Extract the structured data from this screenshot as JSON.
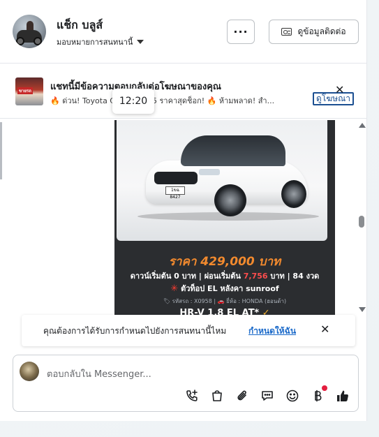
{
  "header": {
    "name": "แช็ก บลูส์",
    "assign_label": "มอบหมายการสนทนานี้",
    "more_label": "···",
    "contact_label": "ดูข้อมูลติดต่อ"
  },
  "ad_banner": {
    "title": "แชทนี้มีข้อความตอบกลับต่อโฆษณาของคุณ",
    "preview": "🔥 ด่วน! Toyota C          rid ปี 2015 ราคาสุดช็อก! 🔥 ห้ามพลาด! สำ...",
    "thumb_text": "ขายรถ",
    "view_ad_label": "ดูโฆษณา",
    "close_label": "✕",
    "tooltip_time": "12:20"
  },
  "ad_image": {
    "price": "ราคา 429,000 บาท",
    "terms_prefix": "ดาวน์เริ่มต้น 0 บาท | ผ่อนเริ่มต้น ",
    "terms_highlight": "7,756",
    "terms_suffix": " บาท | 84 งวด",
    "feature_star": "✳",
    "feature": " ตัวท็อป EL หลังคา sunroof",
    "meta": "🏷 รหัสรถ : X0958 | 🚗 ยี่ห้อ : HONDA (ฮอนด้า)",
    "model": "HR-V 1.8 EL AT*",
    "model_check": " ✓",
    "plate": "1ขฉ 8427"
  },
  "notice": {
    "text": "คุณต้องการได้รับการกำหนดไปยังการสนทนานี้ไหม",
    "link": "กำหนดให้ฉัน",
    "close_label": "✕"
  },
  "composer": {
    "placeholder": "ตอบกลับใน Messenger..."
  },
  "icons": [
    "phone-add-icon",
    "shopping-bag-icon",
    "paperclip-icon",
    "chat-bubble-icon",
    "emoji-icon",
    "baht-icon",
    "thumbs-up-icon"
  ],
  "colors": {
    "link": "#1b6ac9",
    "price": "#f28a2e",
    "notif": "#e41e3f"
  }
}
